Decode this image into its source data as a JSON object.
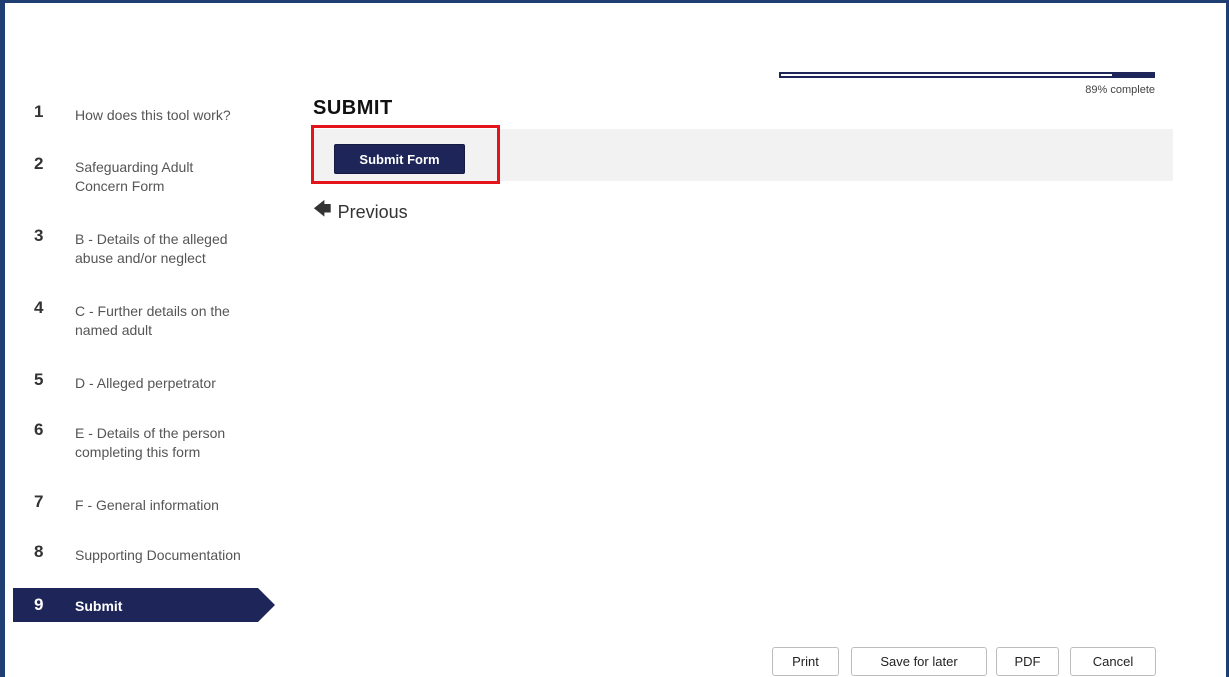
{
  "progress": {
    "fraction": 0.89,
    "label": "89% complete"
  },
  "nav": {
    "items": [
      {
        "number": "1",
        "label": "How does this tool work?"
      },
      {
        "number": "2",
        "label": "Safeguarding Adult Concern Form"
      },
      {
        "number": "3",
        "label": "B - Details of the alleged abuse and/or neglect"
      },
      {
        "number": "4",
        "label": "C - Further details on the named adult"
      },
      {
        "number": "5",
        "label": "D - Alleged perpetrator"
      },
      {
        "number": "6",
        "label": "E - Details of the person completing this form"
      },
      {
        "number": "7",
        "label": "F - General information"
      },
      {
        "number": "8",
        "label": "Supporting Documentation"
      },
      {
        "number": "9",
        "label": "Submit"
      }
    ],
    "active_index": 8
  },
  "main": {
    "title": "SUBMIT",
    "submit_label": "Submit Form",
    "previous_label": "Previous"
  },
  "footer": {
    "print_label": "Print",
    "save_label": "Save for later",
    "pdf_label": "PDF",
    "cancel_label": "Cancel"
  },
  "colors": {
    "brand_navy": "#1e2659",
    "frame_blue": "#1f3f73",
    "highlight_red": "#e3151a"
  }
}
